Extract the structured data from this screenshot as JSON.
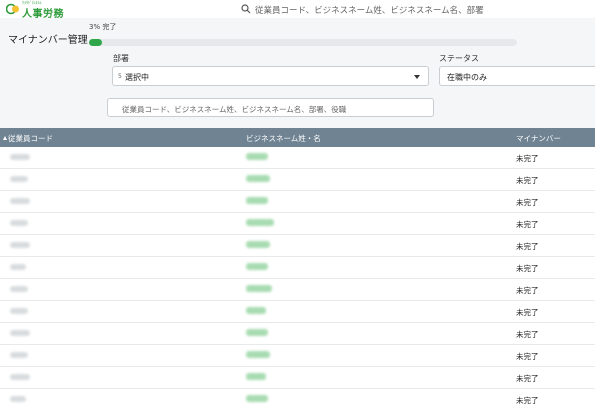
{
  "brand": {
    "small_text": "ｸﾗｳﾄﾞ/ｼｽﾃﾑ",
    "name": "人事労務"
  },
  "search": {
    "icon": "search-icon",
    "placeholder": "従業員コード、ビジネスネーム姓、ビジネスネーム名、部署"
  },
  "page": {
    "title": "マイナンバー管理"
  },
  "progress": {
    "label": "3% 完了",
    "percent": 3,
    "color": "#2fa64a"
  },
  "filters": {
    "department": {
      "label": "部署",
      "count": "5",
      "value": "選択中"
    },
    "status": {
      "label": "ステータス",
      "value": "在職中のみ"
    },
    "keyword": {
      "placeholder": "従業員コード、ビジネスネーム姓、ビジネスネーム名、部署、役職"
    }
  },
  "table": {
    "columns": [
      "従業員コード",
      "ビジネスネーム姓・名",
      "マイナンバー"
    ],
    "header_color": "#708392",
    "rows": [
      {
        "status": "未完了"
      },
      {
        "status": "未完了"
      },
      {
        "status": "未完了"
      },
      {
        "status": "未完了"
      },
      {
        "status": "未完了"
      },
      {
        "status": "未完了"
      },
      {
        "status": "未完了"
      },
      {
        "status": "未完了"
      },
      {
        "status": "未完了"
      },
      {
        "status": "未完了"
      },
      {
        "status": "未完了"
      },
      {
        "status": "未完了"
      }
    ]
  }
}
